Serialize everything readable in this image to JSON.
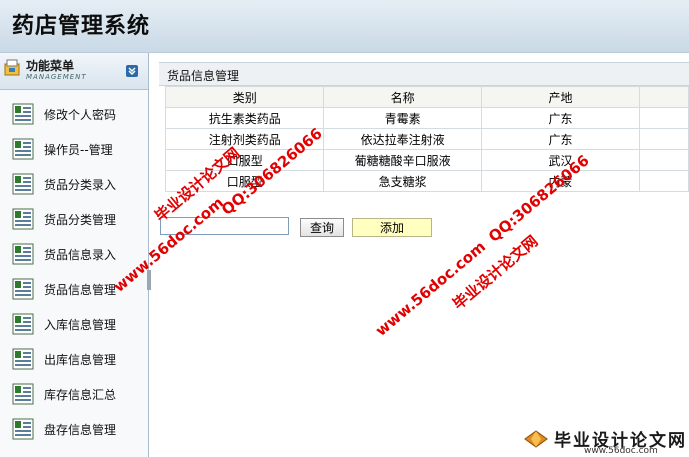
{
  "app": {
    "title": "药店管理系统"
  },
  "menu": {
    "title": "功能菜单",
    "subtitle": "MANAGEMENT",
    "items": [
      {
        "label": "修改个人密码"
      },
      {
        "label": "操作员--管理"
      },
      {
        "label": "货品分类录入"
      },
      {
        "label": "货品分类管理"
      },
      {
        "label": "货品信息录入"
      },
      {
        "label": "货品信息管理"
      },
      {
        "label": "入库信息管理"
      },
      {
        "label": "出库信息管理"
      },
      {
        "label": "库存信息汇总"
      },
      {
        "label": "盘存信息管理"
      }
    ]
  },
  "panel": {
    "title": "货品信息管理",
    "columns": [
      "类别",
      "名称",
      "产地",
      ""
    ],
    "rows": [
      [
        "抗生素类药品",
        "青霉素",
        "广东",
        ""
      ],
      [
        "注射剂类药品",
        "依达拉奉注射液",
        "广东",
        ""
      ],
      [
        "口服型",
        "葡糖糖酸辛口服液",
        "武汉",
        ""
      ],
      [
        "口服型",
        "急支糖浆",
        "内蒙",
        ""
      ]
    ]
  },
  "search": {
    "value": "",
    "query_label": "查询",
    "add_label": "添加"
  },
  "watermark": {
    "site": "www.56doc.com",
    "qq": "QQ:306826066",
    "brand": "毕业设计论文网"
  },
  "footer": {
    "brand": "毕业设计论文网",
    "site": "www.56doc.com"
  },
  "colors": {
    "accent": "#2a6aa8",
    "watermark": "#e20000",
    "add_button": "#ffffc0"
  }
}
